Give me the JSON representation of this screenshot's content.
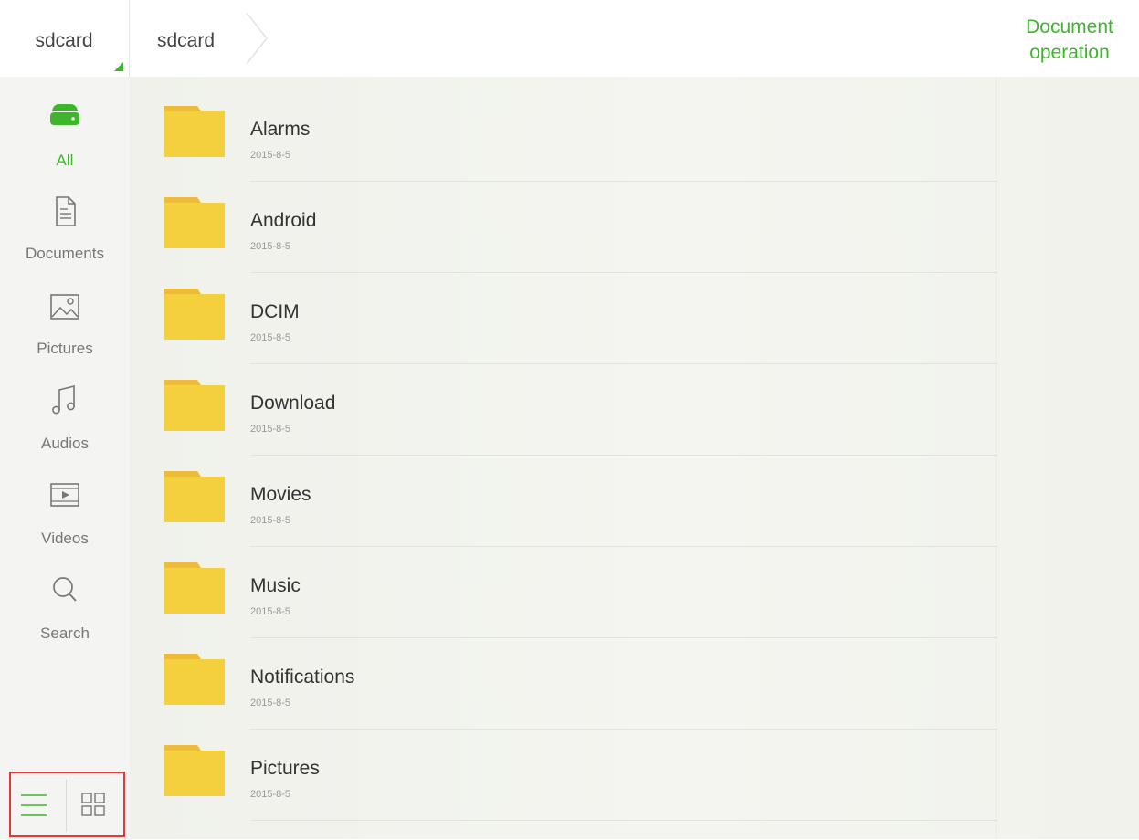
{
  "header": {
    "storage_label": "sdcard",
    "breadcrumb": [
      "sdcard"
    ],
    "document_operation": [
      "Document",
      "operation"
    ]
  },
  "sidebar": {
    "items": [
      {
        "label": "All",
        "icon": "drive-icon",
        "active": true
      },
      {
        "label": "Documents",
        "icon": "document-icon",
        "active": false
      },
      {
        "label": "Pictures",
        "icon": "picture-icon",
        "active": false
      },
      {
        "label": "Audios",
        "icon": "music-note-icon",
        "active": false
      },
      {
        "label": "Videos",
        "icon": "video-icon",
        "active": false
      },
      {
        "label": "Search",
        "icon": "search-icon",
        "active": false
      }
    ],
    "view_toggle": {
      "list_icon": "list-view-icon",
      "grid_icon": "grid-view-icon",
      "selected": "list"
    }
  },
  "files": [
    {
      "name": "Alarms",
      "date": "2015-8-5"
    },
    {
      "name": "Android",
      "date": "2015-8-5"
    },
    {
      "name": "DCIM",
      "date": "2015-8-5"
    },
    {
      "name": "Download",
      "date": "2015-8-5"
    },
    {
      "name": "Movies",
      "date": "2015-8-5"
    },
    {
      "name": "Music",
      "date": "2015-8-5"
    },
    {
      "name": "Notifications",
      "date": "2015-8-5"
    },
    {
      "name": "Pictures",
      "date": "2015-8-5"
    }
  ],
  "colors": {
    "accent": "#3db62a",
    "folder": "#f4d03f",
    "folder_tab": "#efbb3a",
    "highlight": "#e53935"
  }
}
